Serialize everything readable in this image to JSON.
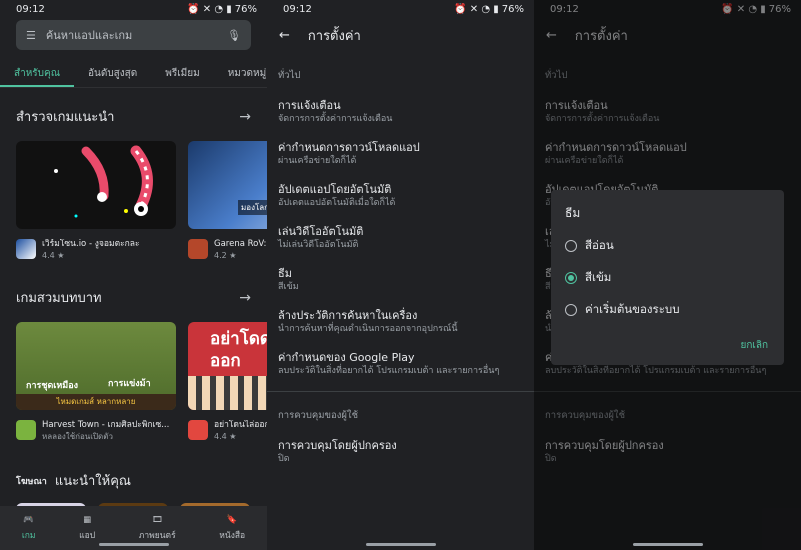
{
  "status": {
    "time": "09:12",
    "battery": "76%"
  },
  "store": {
    "search_placeholder": "ค้นหาแอปและเกม",
    "tabs": [
      "สำหรับคุณ",
      "อันดับสูงสุด",
      "พรีเมียม",
      "หมวดหมู่"
    ],
    "section1_title": "สำรวจเกมแนะนำ",
    "section1_apps": [
      {
        "name": "เวิร์มโซน.io - งูจอมตะกละ",
        "rating": "4.4 ★"
      },
      {
        "name": "Garena RoV: Mob",
        "rating": "4.2 ★"
      }
    ],
    "card2_overlay": "มองโลกผ่าน",
    "section2_title": "เกมสวมบทบาท",
    "section2_banner1a": "การชุดเหมือง",
    "section2_banner1b": "การแข่งม้า",
    "section2_banner1c": "ไหมดเกมส์ หลากหลาย",
    "section2_banner2": "อย่าโดด ออก",
    "section2_apps": [
      {
        "name": "Harvest Town - เกมศิลปะพิกเซ...",
        "sub": "หลลองใช้ก่อนเปิดตัว"
      },
      {
        "name": "อย่าโดนไล่ออก",
        "sub": "4.4 ★"
      }
    ],
    "ads_label": "โฆษณา",
    "section3_title": "แนะนำให้คุณ",
    "nav": [
      "เกม",
      "แอป",
      "ภาพยนตร์",
      "หนังสือ"
    ]
  },
  "settings": {
    "title": "การตั้งค่า",
    "group1": "ทั่วไป",
    "items": [
      {
        "title": "การแจ้งเตือน",
        "sub": "จัดการการตั้งค่าการแจ้งเตือน"
      },
      {
        "title": "ค่ากำหนดการดาวน์โหลดแอป",
        "sub": "ผ่านเครือข่ายใดก็ได้"
      },
      {
        "title": "อัปเดตแอปโดยอัตโนมัติ",
        "sub": "อัปเดตแอปอัตโนมัติเมื่อใดก็ได้"
      },
      {
        "title": "เล่นวิดีโออัตโนมัติ",
        "sub": "ไม่เล่นวิดีโออัตโนมัติ"
      },
      {
        "title": "ธีม",
        "sub": "สีเข้ม"
      },
      {
        "title": "ล้างประวัติการค้นหาในเครื่อง",
        "sub": "นำการค้นหาที่คุณดำเนินการออกจากอุปกรณ์นี้"
      },
      {
        "title": "ค่ากำหนดของ Google Play",
        "sub": "ลบประวัติในสิ่งที่อยากได้ โปรแกรมเบต้า และรายการอื่นๆ"
      }
    ],
    "group2": "การควบคุมของผู้ใช้",
    "parental": {
      "title": "การควบคุมโดยผู้ปกครอง",
      "sub": "ปิด"
    }
  },
  "dialog": {
    "title": "ธีม",
    "options": [
      "สีอ่อน",
      "สีเข้ม",
      "ค่าเริ่มต้นของระบบ"
    ],
    "selected": "สีเข้ม",
    "cancel": "ยกเลิก"
  },
  "colors": {
    "accent": "#50c3a0",
    "background": "#202124"
  }
}
